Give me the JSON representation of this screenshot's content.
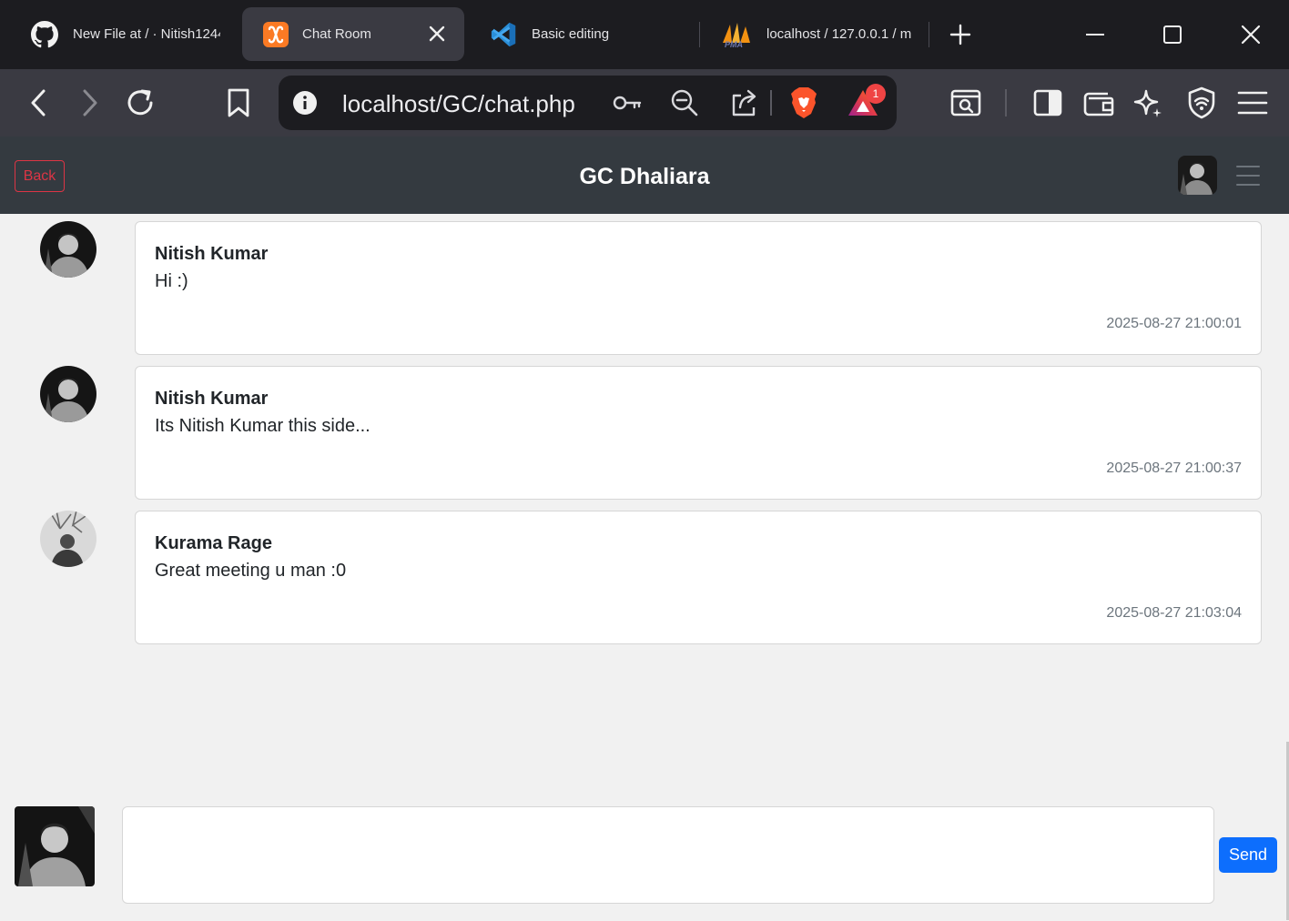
{
  "browser": {
    "tabs": [
      {
        "title": "New File at / · Nitish1244",
        "icon": "github-icon",
        "active": false
      },
      {
        "title": "Chat Room",
        "icon": "xampp-icon",
        "active": true
      },
      {
        "title": "Basic editing",
        "icon": "vscode-icon",
        "active": false
      },
      {
        "title": "localhost / 127.0.0.1 / m",
        "icon": "phpmyadmin-icon",
        "active": false
      }
    ],
    "address": {
      "url": "localhost/GC/chat.php"
    },
    "rewards_badge": "1"
  },
  "app": {
    "back_label": "Back",
    "room_title": "GC Dhaliara",
    "send_label": "Send",
    "composer_value": "",
    "messages": [
      {
        "author": "Nitish Kumar",
        "text": "Hi :)",
        "time": "2025-08-27 21:00:01",
        "avatar": "dark-portrait-avatar"
      },
      {
        "author": "Nitish Kumar",
        "text": "Its Nitish Kumar this side...",
        "time": "2025-08-27 21:00:37",
        "avatar": "dark-portrait-avatar"
      },
      {
        "author": "Kurama Rage",
        "text": "Great meeting u man :0",
        "time": "2025-08-27 21:03:04",
        "avatar": "tree-portrait-avatar"
      }
    ]
  },
  "colors": {
    "tab_bar": "#1c1c20",
    "toolbar": "#3a3a42",
    "app_header": "#343a40",
    "chat_bg": "#f1f1f1",
    "back_button": "#dc3545",
    "send_button": "#0d6efd",
    "brave_lion": "#fb542b"
  }
}
